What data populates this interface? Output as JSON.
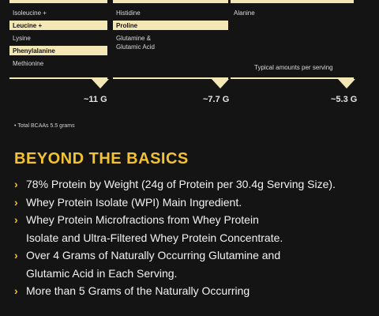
{
  "amino_columns": [
    {
      "items": [
        {
          "label": "Isoleucine +",
          "highlight": false
        },
        {
          "label": "Leucine +",
          "highlight": true
        },
        {
          "label": "Lysine",
          "highlight": false
        },
        {
          "label": "Phenylalanine",
          "highlight": true
        },
        {
          "label": "Methionine",
          "highlight": false
        }
      ]
    },
    {
      "items": [
        {
          "label": "Histidine",
          "highlight": false
        },
        {
          "label": "Proline",
          "highlight": true
        },
        {
          "label": "Glutamine &\nGlutamic Acid",
          "highlight": false
        }
      ]
    },
    {
      "items": [
        {
          "label": "Alanine",
          "highlight": false
        }
      ]
    }
  ],
  "typical_amounts_label": "Typical amounts per serving",
  "amounts": [
    "~11 G",
    "~7.7 G",
    "~5.3 G"
  ],
  "footnote": "• Total BCAAs 5.5 grams",
  "section_title": "BEYOND THE BASICS",
  "bullets": [
    "78% Protein by Weight (24g of Protein per 30.4g Serving Size).",
    "Whey Protein Isolate (WPI) Main Ingredient.",
    "Whey Protein Microfractions from Whey Protein\nIsolate and Ultra-Filtered Whey Protein Concentrate.",
    "Over 4 Grams of Naturally Occurring Glutamine and\nGlutamic Acid in Each Serving.",
    "More than 5 Grams of the Naturally Occurring"
  ],
  "colors": {
    "background": "#141414",
    "chip": "#f3e7b6",
    "accent": "#f1c232"
  }
}
